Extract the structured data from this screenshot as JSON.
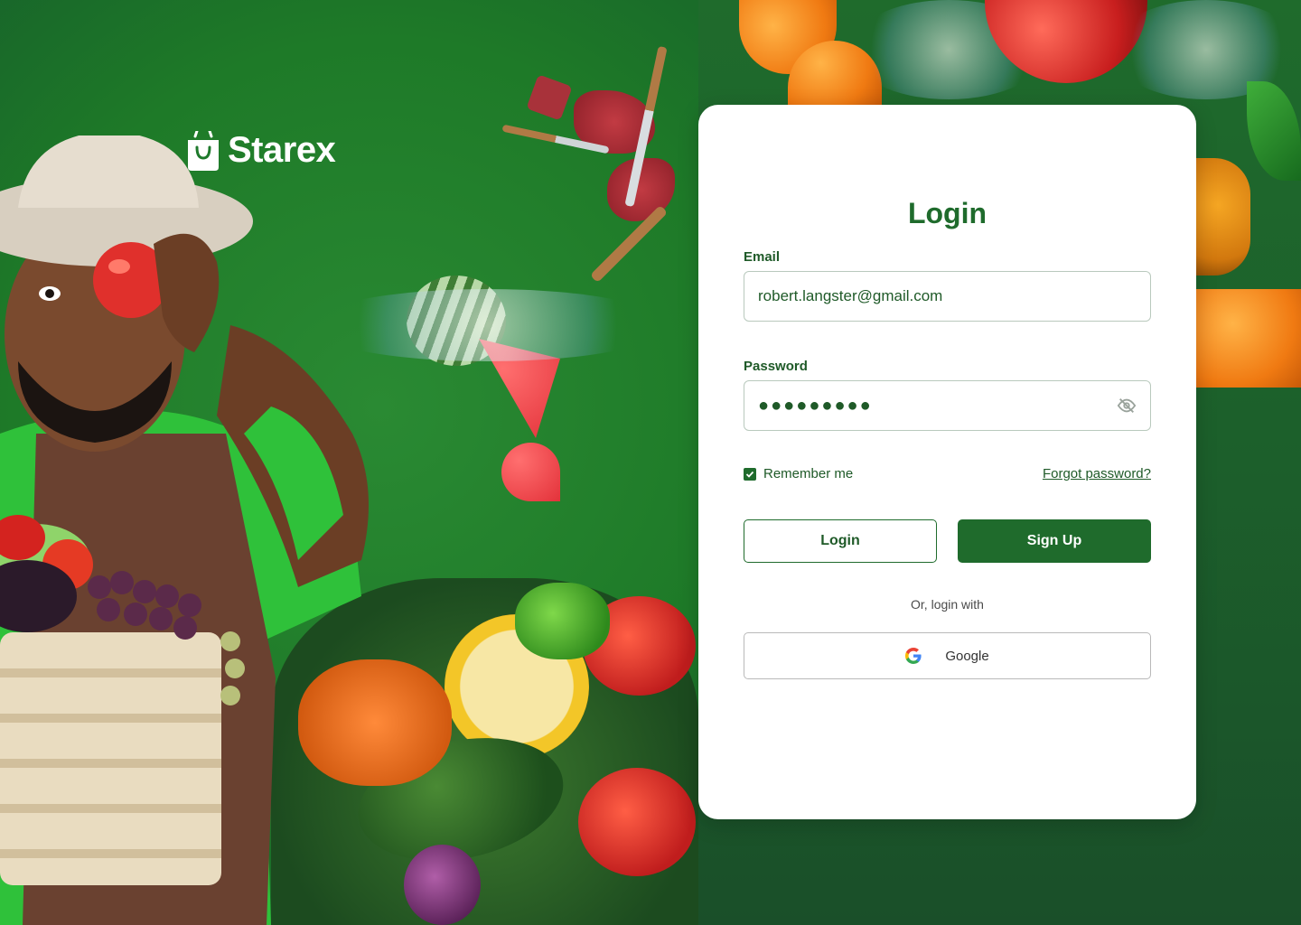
{
  "brand": {
    "name": "Starex"
  },
  "login_card": {
    "title": "Login",
    "email": {
      "label": "Email",
      "value": "robert.langster@gmail.com"
    },
    "password": {
      "label": "Password",
      "masked_value": "●●●●●●●●●",
      "toggle_icon": "eye-off-icon"
    },
    "remember_me": {
      "label": "Remember me",
      "checked": true
    },
    "forgot_password": "Forgot password?",
    "login_button": "Login",
    "signup_button": "Sign Up",
    "divider_text": "Or, login with",
    "google_button": "Google"
  },
  "colors": {
    "brand_green": "#1f6b2c",
    "background_green": "#1f7a2c",
    "card": "#ffffff"
  }
}
